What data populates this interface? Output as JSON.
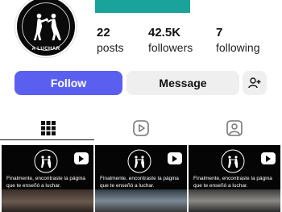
{
  "profile": {
    "avatar_text": "A LUCHAR",
    "stats": [
      {
        "value": "22",
        "label": "posts"
      },
      {
        "value": "42.5K",
        "label": "followers"
      },
      {
        "value": "7",
        "label": "following"
      }
    ]
  },
  "actions": {
    "follow_label": "Follow",
    "message_label": "Message",
    "add_user_icon": "person-add-icon"
  },
  "tabs": [
    {
      "icon": "grid-icon",
      "active": true
    },
    {
      "icon": "reels-icon",
      "active": false
    },
    {
      "icon": "tagged-icon",
      "active": false
    }
  ],
  "posts": [
    {
      "caption": "Finalmente, encontraste la página que te enseñó a luchar."
    },
    {
      "caption": "Finalmente, encontraste la página que te enseñó a luchar."
    },
    {
      "caption": "Finalmente, encontraste la página que te enseñó a luchar."
    }
  ],
  "colors": {
    "follow_button": "#5b5ff0",
    "secondary_button": "#efefef",
    "banner": "#1aa39a"
  }
}
